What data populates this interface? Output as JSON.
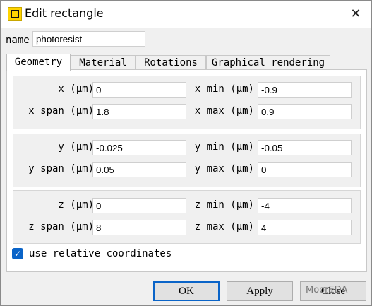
{
  "window": {
    "title": "Edit rectangle"
  },
  "name": {
    "label": "name",
    "value": "photoresist"
  },
  "tabs": [
    "Geometry",
    "Material",
    "Rotations",
    "Graphical rendering"
  ],
  "groups": [
    {
      "rows": [
        {
          "left_label": "x (μm)",
          "left_value": "0",
          "right_label": "x min (μm)",
          "right_value": "-0.9"
        },
        {
          "left_label": "x span (μm)",
          "left_value": "1.8",
          "right_label": "x max (μm)",
          "right_value": "0.9"
        }
      ]
    },
    {
      "rows": [
        {
          "left_label": "y (μm)",
          "left_value": "-0.025",
          "right_label": "y min (μm)",
          "right_value": "-0.05"
        },
        {
          "left_label": "y span (μm)",
          "left_value": "0.05",
          "right_label": "y max (μm)",
          "right_value": "0"
        }
      ]
    },
    {
      "rows": [
        {
          "left_label": "z (μm)",
          "left_value": "0",
          "right_label": "z min (μm)",
          "right_value": "-4"
        },
        {
          "left_label": "z span (μm)",
          "left_value": "8",
          "right_label": "z max (μm)",
          "right_value": "4"
        }
      ]
    }
  ],
  "relative_coords": {
    "checked": true,
    "label": "use relative coordinates"
  },
  "buttons": {
    "ok": "OK",
    "apply": "Apply",
    "close": "Close"
  },
  "watermark": "MoorEDA",
  "colors": {
    "accent": "#0a64c8",
    "icon": "#ffd400"
  }
}
